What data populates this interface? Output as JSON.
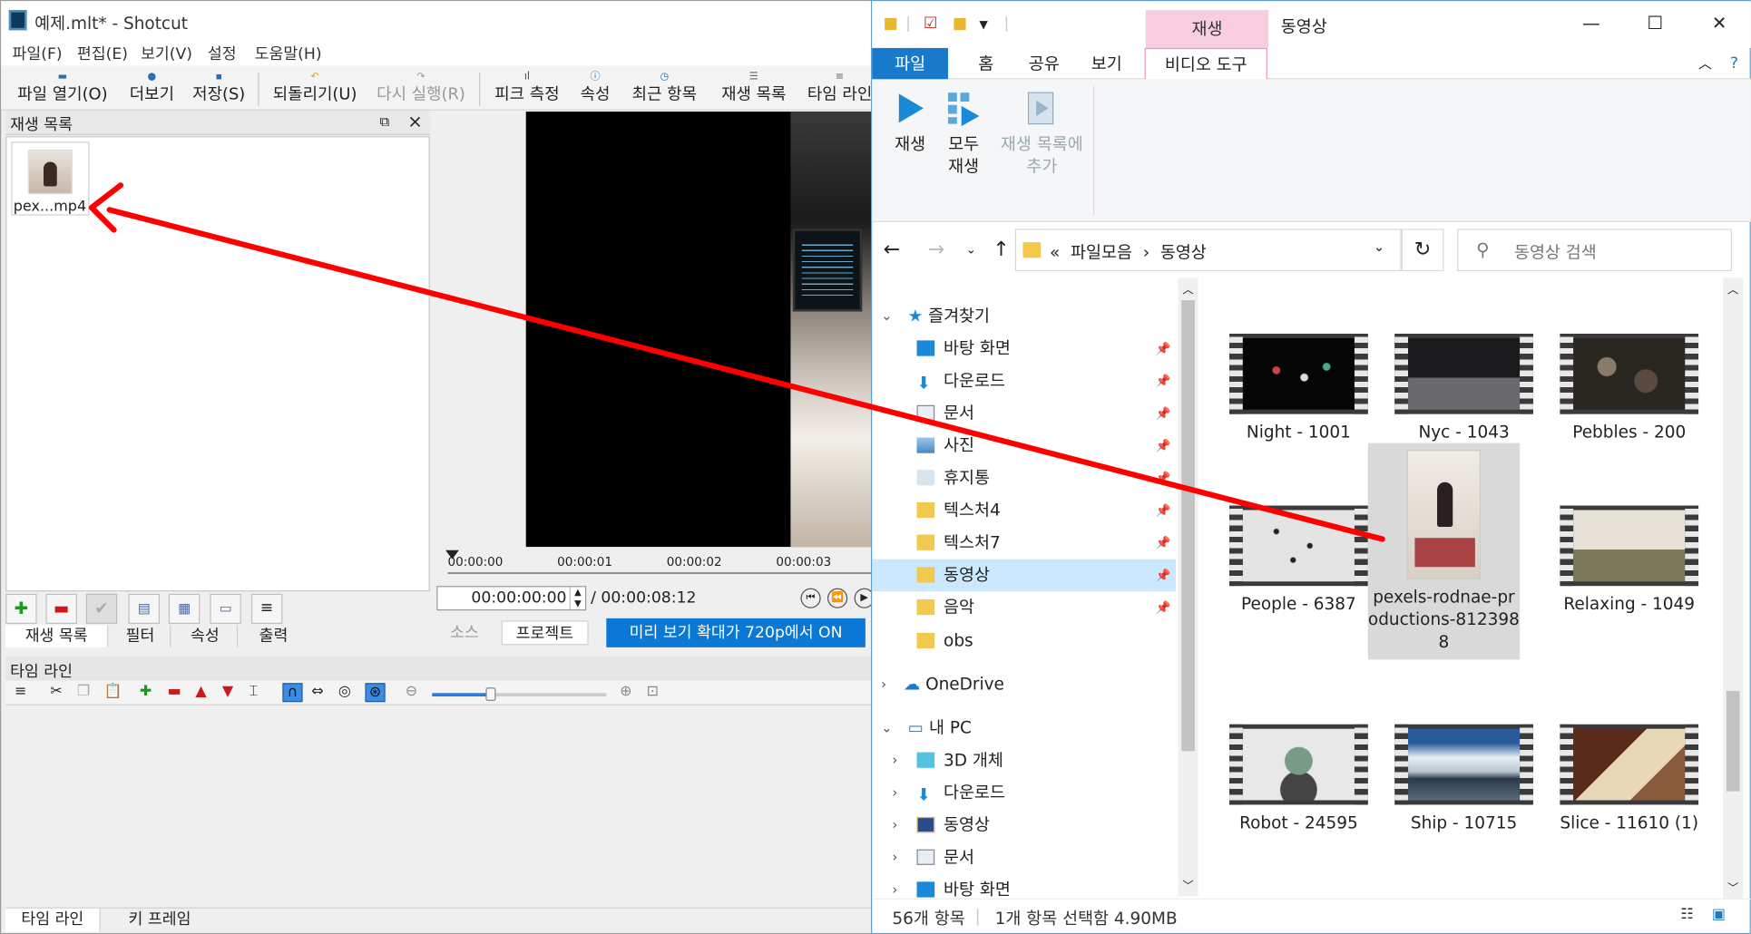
{
  "shotcut": {
    "title": "예제.mlt* - Shotcut",
    "menu": [
      "파일(F)",
      "편집(E)",
      "보기(V)",
      "설정",
      "도움말(H)"
    ],
    "toolbar": {
      "open": "파일 열기(O)",
      "more": "더보기",
      "save": "저장(S)",
      "undo": "되돌리기(U)",
      "redo": "다시 실행(R)",
      "peak": "피크 측정",
      "props": "속성",
      "recent": "최근 항목",
      "playlist": "재생 목록",
      "timeline": "타임 라인"
    },
    "playlist": {
      "title": "재생 목록",
      "clip_label": "pex...mp4",
      "tabs": [
        "재생 목록",
        "필터",
        "속성",
        "출력"
      ]
    },
    "player": {
      "ticks": [
        "00:00:00",
        "00:00:01",
        "00:00:02",
        "00:00:03"
      ],
      "timecode": "00:00:00:00",
      "duration": "/ 00:00:08:12",
      "source_tab": "소스",
      "project_tab": "프로젝트",
      "zoom_button": "미리 보기 확대가 720p에서 ON"
    },
    "timeline": {
      "title": "타임 라인",
      "tabs": [
        "타임 라인",
        "키 프레임"
      ]
    }
  },
  "explorer": {
    "context_tab": "재생",
    "window_title": "동영상",
    "ribbon_tabs": [
      "파일",
      "홈",
      "공유",
      "보기",
      "비디오 도구"
    ],
    "ribbon_buttons": {
      "play": "재생",
      "play_all_1": "모두",
      "play_all_2": "재생",
      "add_1": "재생 목록에",
      "add_2": "추가"
    },
    "address": {
      "prefix": "«",
      "crumb1": "파일모음",
      "sep": "›",
      "crumb2": "동영상"
    },
    "search_placeholder": "동영상 검색",
    "tree": {
      "quick_access": "즐겨찾기",
      "items": [
        "바탕 화면",
        "다운로드",
        "문서",
        "사진",
        "휴지통",
        "텍스처4",
        "텍스처7",
        "동영상",
        "음악",
        "obs"
      ],
      "onedrive": "OneDrive",
      "pc": "내 PC",
      "pc_items": [
        "3D 개체",
        "다운로드",
        "동영상",
        "문서",
        "바탕 화면"
      ]
    },
    "files": [
      {
        "name": "Night - 1001"
      },
      {
        "name": "Nyc - 1043"
      },
      {
        "name": "Pebbles - 200"
      },
      {
        "name": "People - 6387"
      },
      {
        "name": "pexels-rodnae-productions-8123988",
        "line1": "pexels-rodnae-pr",
        "line2": "oductions-812398",
        "line3": "8"
      },
      {
        "name": "Relaxing - 1049"
      },
      {
        "name": "Robot - 24595"
      },
      {
        "name": "Ship - 10715"
      },
      {
        "name": "Slice - 11610 (1)"
      }
    ],
    "status": {
      "count": "56개 항목",
      "selection": "1개 항목 선택함 4.90MB"
    }
  },
  "colors": {
    "file_tab": "#1979ca",
    "context_tab": "#f8cde0",
    "zoom_button": "#0b78d6",
    "selected_tree": "#cce8ff",
    "arrow": "#ff0000"
  }
}
